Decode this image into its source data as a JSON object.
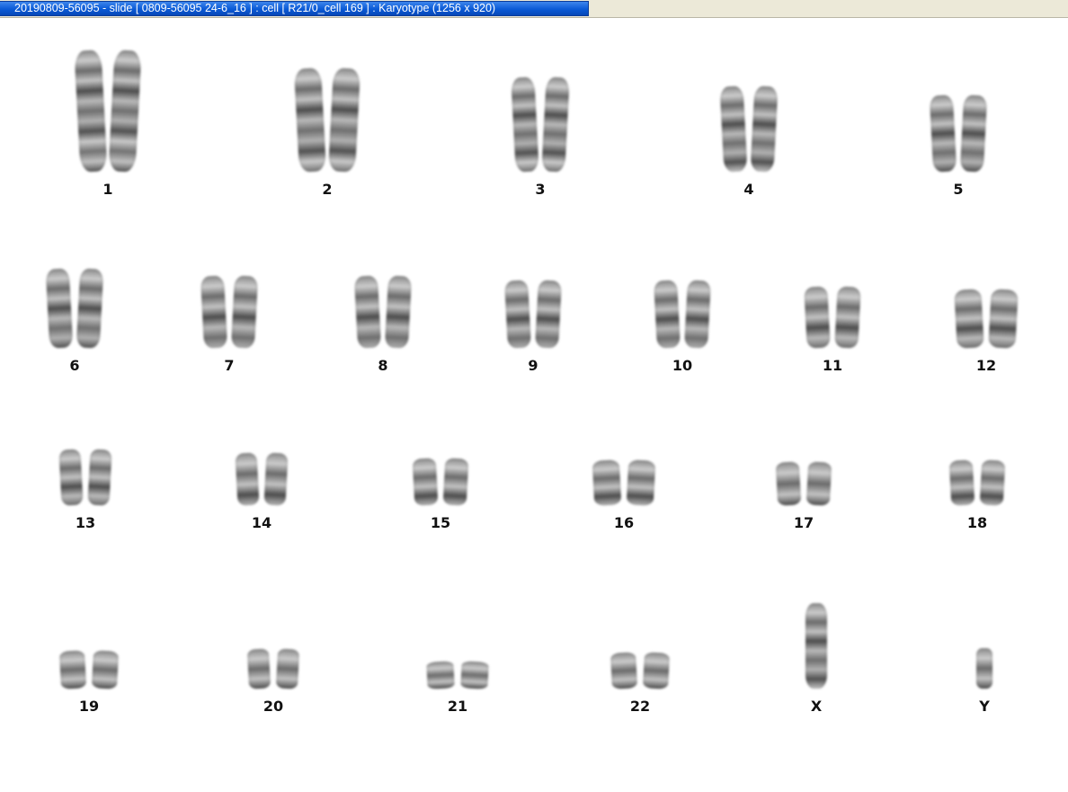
{
  "window": {
    "title": "20190809-56095 - slide [ 0809-56095 24-6_16 ] : cell [ R21/0_cell 169 ] : Karyotype  (1256 x 920)"
  },
  "karyotype": {
    "chromosomes": [
      {
        "label": "1"
      },
      {
        "label": "2"
      },
      {
        "label": "3"
      },
      {
        "label": "4"
      },
      {
        "label": "5"
      },
      {
        "label": "6"
      },
      {
        "label": "7"
      },
      {
        "label": "8"
      },
      {
        "label": "9"
      },
      {
        "label": "10"
      },
      {
        "label": "11"
      },
      {
        "label": "12"
      },
      {
        "label": "13"
      },
      {
        "label": "14"
      },
      {
        "label": "15"
      },
      {
        "label": "16"
      },
      {
        "label": "17"
      },
      {
        "label": "18"
      },
      {
        "label": "19"
      },
      {
        "label": "20"
      },
      {
        "label": "21"
      },
      {
        "label": "22"
      },
      {
        "label": "X"
      },
      {
        "label": "Y"
      }
    ]
  }
}
